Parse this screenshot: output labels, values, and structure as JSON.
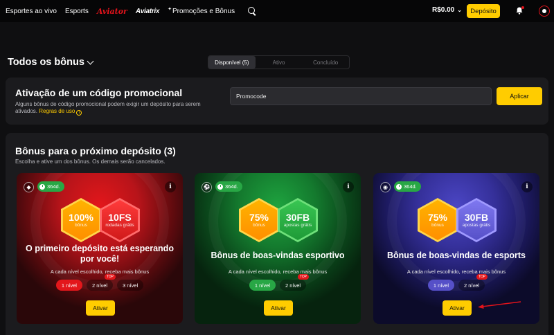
{
  "topbar": {
    "nav": [
      "Esportes ao vivo",
      "Esports",
      "Aviator",
      "Aviatrix",
      "Promoções e Bônus"
    ],
    "balance": "R$0.00",
    "deposit_label": "Depósito"
  },
  "page": {
    "title": "Todos os bônus",
    "tabs": [
      "Disponível (5)",
      "Ativo",
      "Concluído"
    ]
  },
  "promo": {
    "title": "Ativação de um código promocional",
    "description": "Alguns bônus de código promocional podem exigir um depósito para serem ativados.",
    "rules_link": "Regras de uso",
    "input_placeholder": "Promocode",
    "apply_label": "Aplicar"
  },
  "bonuses": {
    "title": "Bônus para o próximo depósito (3)",
    "subtitle": "Escolha e ative um dos bônus. Os demais serão cancelados.",
    "cards": [
      {
        "days": "364d.",
        "hex1_big": "100%",
        "hex1_small": "bônus",
        "hex2_big": "10FS",
        "hex2_small": "rodadas grátis",
        "title": "O primeiro depósito está esperando por você!",
        "desc": "A cada nível escolhido, receba mais bônus",
        "levels": [
          "1 nível",
          "2 nível",
          "3 nível"
        ],
        "top_badge": "TOP",
        "button": "Ativar"
      },
      {
        "days": "364d.",
        "hex1_big": "75%",
        "hex1_small": "bônus",
        "hex2_big": "30FB",
        "hex2_small": "apostas grátis",
        "title": "Bônus de boas-vindas esportivo",
        "desc": "A cada nível escolhido, receba mais bônus",
        "levels": [
          "1 nível",
          "2 nível"
        ],
        "top_badge": "TOP",
        "button": "Ativar"
      },
      {
        "days": "364d.",
        "hex1_big": "75%",
        "hex1_small": "bônus",
        "hex2_big": "30FB",
        "hex2_small": "apostas grátis",
        "title": "Bônus de boas-vindas de esports",
        "desc": "A cada nível escolhido, receba mais bônus",
        "levels": [
          "1 nível",
          "2 nível"
        ],
        "top_badge": "TOP",
        "button": "Ativar"
      }
    ]
  },
  "colors": {
    "accent": "#ffcc00",
    "red": "#e3131b",
    "green": "#28a745",
    "purple": "#5650c8"
  }
}
